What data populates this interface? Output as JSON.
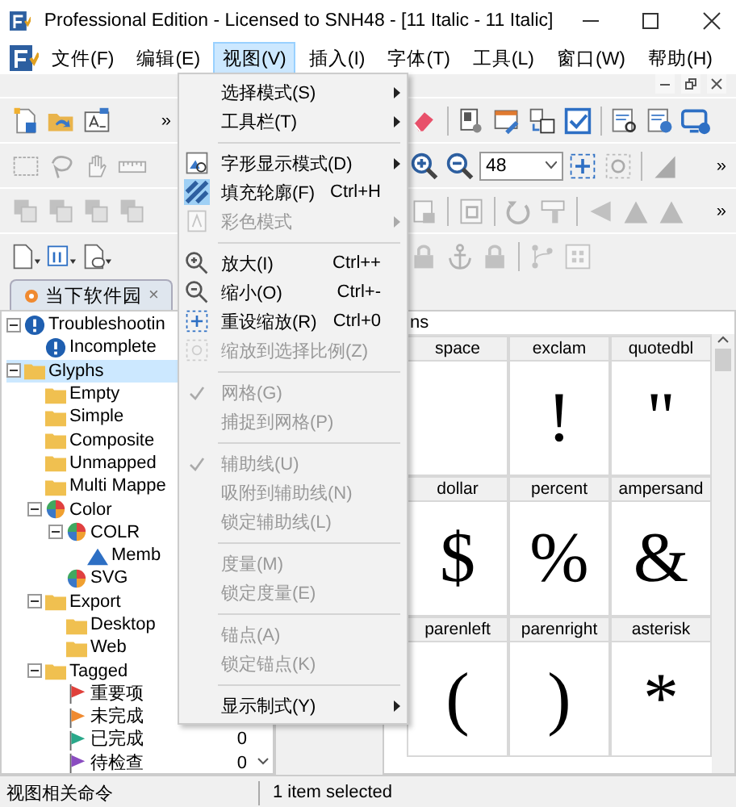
{
  "window": {
    "title": "Professional Edition - Licensed to SNH48 - [11 Italic - 11 Italic]"
  },
  "menubar": [
    {
      "label": "文件(F)",
      "selected": false
    },
    {
      "label": "编辑(E)",
      "selected": false
    },
    {
      "label": "视图(V)",
      "selected": true
    },
    {
      "label": "插入(I)",
      "selected": false
    },
    {
      "label": "字体(T)",
      "selected": false
    },
    {
      "label": "工具(L)",
      "selected": false
    },
    {
      "label": "窗口(W)",
      "selected": false
    },
    {
      "label": "帮助(H)",
      "selected": false
    }
  ],
  "toolbars": [
    {
      "left": [
        {
          "kind": "button",
          "disabled": false
        },
        {
          "kind": "button",
          "disabled": false
        },
        {
          "kind": "button",
          "disabled": false
        },
        {
          "kind": "overflow",
          "label": "»"
        }
      ],
      "right": [
        {
          "kind": "button",
          "disabled": false
        },
        {
          "kind": "separator"
        },
        {
          "kind": "button",
          "disabled": false
        },
        {
          "kind": "button",
          "disabled": false
        },
        {
          "kind": "button",
          "disabled": false
        },
        {
          "kind": "button",
          "disabled": false
        },
        {
          "kind": "separator"
        },
        {
          "kind": "button",
          "disabled": false
        },
        {
          "kind": "button",
          "disabled": false
        },
        {
          "kind": "button",
          "disabled": false
        }
      ]
    },
    {
      "left": [
        {
          "kind": "button",
          "disabled": true
        },
        {
          "kind": "button",
          "disabled": true
        },
        {
          "kind": "button",
          "disabled": true
        },
        {
          "kind": "button",
          "disabled": true
        }
      ],
      "right": [
        {
          "kind": "button",
          "disabled": false
        },
        {
          "kind": "button",
          "disabled": false
        },
        {
          "kind": "combo",
          "value": "48"
        },
        {
          "kind": "button",
          "disabled": false
        },
        {
          "kind": "button",
          "disabled": true
        },
        {
          "kind": "separator"
        },
        {
          "kind": "button",
          "disabled": true
        },
        {
          "kind": "overflow",
          "label": "»"
        }
      ]
    },
    {
      "left": [
        {
          "kind": "button",
          "disabled": true
        },
        {
          "kind": "button",
          "disabled": true
        },
        {
          "kind": "button",
          "disabled": true
        },
        {
          "kind": "button",
          "disabled": true
        }
      ],
      "right": [
        {
          "kind": "button",
          "disabled": true
        },
        {
          "kind": "separator"
        },
        {
          "kind": "button",
          "disabled": true
        },
        {
          "kind": "separator"
        },
        {
          "kind": "button",
          "disabled": true
        },
        {
          "kind": "button",
          "disabled": true
        },
        {
          "kind": "separator"
        },
        {
          "kind": "button",
          "disabled": true
        },
        {
          "kind": "button",
          "disabled": true
        },
        {
          "kind": "button",
          "disabled": true
        },
        {
          "kind": "overflow",
          "label": "»"
        }
      ]
    },
    {
      "left": [
        {
          "kind": "button",
          "disabled": false
        },
        {
          "kind": "button",
          "disabled": false
        },
        {
          "kind": "button",
          "disabled": false
        }
      ],
      "right": [
        {
          "kind": "button",
          "disabled": true
        },
        {
          "kind": "button",
          "disabled": true
        },
        {
          "kind": "button",
          "disabled": true
        },
        {
          "kind": "separator"
        },
        {
          "kind": "button",
          "disabled": true
        },
        {
          "kind": "button",
          "disabled": true
        }
      ]
    }
  ],
  "doc_tab": {
    "label": "当下软件园",
    "close": "×"
  },
  "tree": [
    {
      "label": "Troubleshootin",
      "kind": "issue",
      "expanded": true,
      "selected": false,
      "children": [
        {
          "label": "Incomplete",
          "kind": "issue",
          "selected": false
        }
      ]
    },
    {
      "label": "Glyphs",
      "kind": "folder",
      "expanded": true,
      "selected": true,
      "children": [
        {
          "label": "Empty",
          "kind": "folder",
          "selected": false
        },
        {
          "label": "Simple",
          "kind": "folder",
          "selected": false
        },
        {
          "label": "Composite",
          "kind": "folder",
          "selected": false
        },
        {
          "label": "Unmapped",
          "kind": "folder",
          "selected": false
        },
        {
          "label": "Multi Mappe",
          "kind": "folder",
          "selected": false
        },
        {
          "label": "Color",
          "kind": "palette",
          "expanded": true,
          "selected": false,
          "children": [
            {
              "label": "COLR",
              "kind": "palette",
              "expanded": true,
              "selected": false,
              "children": [
                {
                  "label": "Memb",
                  "kind": "triangle",
                  "selected": false
                }
              ]
            },
            {
              "label": "SVG",
              "kind": "palette",
              "selected": false
            }
          ]
        },
        {
          "label": "Export",
          "kind": "folder",
          "expanded": true,
          "selected": false,
          "children": [
            {
              "label": "Desktop",
              "kind": "folder",
              "selected": false
            },
            {
              "label": "Web",
              "kind": "folder",
              "selected": false
            }
          ]
        },
        {
          "label": "Tagged",
          "kind": "folder",
          "expanded": true,
          "selected": false,
          "children": [
            {
              "label": "重要项",
              "kind": "flag",
              "color": "#e0403a",
              "selected": false
            },
            {
              "label": "未完成",
              "kind": "flag",
              "color": "#f08a30",
              "selected": false
            },
            {
              "label": "已完成",
              "kind": "flag",
              "color": "#2aa88a",
              "selected": false,
              "count": "0"
            },
            {
              "label": "待检查",
              "kind": "flag",
              "color": "#8a4cc0",
              "selected": false,
              "count": "0"
            }
          ]
        }
      ]
    }
  ],
  "glyph_panel": {
    "title": "ns",
    "cells": [
      {
        "name": "space"
      },
      {
        "name": "exclam",
        "glyph": "!"
      },
      {
        "name": "quotedbl",
        "glyph": "\""
      },
      {
        "name": "dollar",
        "glyph": "$"
      },
      {
        "name": "percent",
        "glyph": "%"
      },
      {
        "name": "ampersand",
        "glyph": "&"
      },
      {
        "name": "parenleft",
        "glyph": "("
      },
      {
        "name": "parenright",
        "glyph": ")"
      },
      {
        "name": "asterisk",
        "glyph": "*"
      }
    ]
  },
  "view_menu": [
    {
      "kind": "item",
      "label": "选择模式(S)",
      "submenu": true,
      "disabled": false,
      "checked": false
    },
    {
      "kind": "item",
      "label": "工具栏(T)",
      "submenu": true,
      "disabled": false,
      "checked": false
    },
    {
      "kind": "separator"
    },
    {
      "kind": "item",
      "label": "字形显示模式(D)",
      "submenu": true,
      "disabled": false,
      "checked": false
    },
    {
      "kind": "item",
      "label": "填充轮廓(F)",
      "shortcut": "Ctrl+H",
      "submenu": false,
      "disabled": false,
      "checked": true
    },
    {
      "kind": "item",
      "label": "彩色模式",
      "submenu": true,
      "disabled": true,
      "checked": false
    },
    {
      "kind": "separator"
    },
    {
      "kind": "item",
      "label": "放大(I)",
      "shortcut": "Ctrl++",
      "submenu": false,
      "disabled": false,
      "checked": false
    },
    {
      "kind": "item",
      "label": "缩小(O)",
      "shortcut": "Ctrl+-",
      "submenu": false,
      "disabled": false,
      "checked": false
    },
    {
      "kind": "item",
      "label": "重设缩放(R)",
      "shortcut": "Ctrl+0",
      "submenu": false,
      "disabled": false,
      "checked": false
    },
    {
      "kind": "item",
      "label": "缩放到选择比例(Z)",
      "submenu": false,
      "disabled": true,
      "checked": false
    },
    {
      "kind": "separator"
    },
    {
      "kind": "item",
      "label": "网格(G)",
      "submenu": false,
      "disabled": true,
      "checked": true
    },
    {
      "kind": "item",
      "label": "捕捉到网格(P)",
      "submenu": false,
      "disabled": true,
      "checked": false
    },
    {
      "kind": "separator"
    },
    {
      "kind": "item",
      "label": "辅助线(U)",
      "submenu": false,
      "disabled": true,
      "checked": true
    },
    {
      "kind": "item",
      "label": "吸附到辅助线(N)",
      "submenu": false,
      "disabled": true,
      "checked": false
    },
    {
      "kind": "item",
      "label": "锁定辅助线(L)",
      "submenu": false,
      "disabled": true,
      "checked": false
    },
    {
      "kind": "separator"
    },
    {
      "kind": "item",
      "label": "度量(M)",
      "submenu": false,
      "disabled": true,
      "checked": false
    },
    {
      "kind": "item",
      "label": "锁定度量(E)",
      "submenu": false,
      "disabled": true,
      "checked": false
    },
    {
      "kind": "separator"
    },
    {
      "kind": "item",
      "label": "锚点(A)",
      "submenu": false,
      "disabled": true,
      "checked": false
    },
    {
      "kind": "item",
      "label": "锁定锚点(K)",
      "submenu": false,
      "disabled": true,
      "checked": false
    },
    {
      "kind": "separator"
    },
    {
      "kind": "item",
      "label": "显示制式(Y)",
      "submenu": true,
      "disabled": false,
      "checked": false
    }
  ],
  "status_bar": [
    "视图相关命令",
    "1 item selected"
  ]
}
